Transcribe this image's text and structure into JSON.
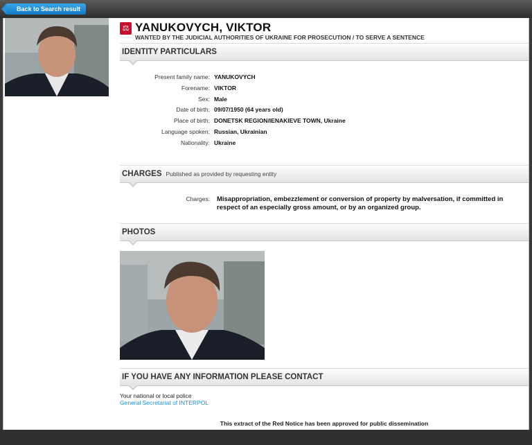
{
  "nav": {
    "back_label": "Back to Search result"
  },
  "header": {
    "name": "YANUKOVYCH, VIKTOR",
    "subtitle": "WANTED BY THE JUDICIAL AUTHORITIES OF UKRAINE FOR PROSECUTION / TO SERVE A SENTENCE",
    "logo_icon": "interpol-logo-icon"
  },
  "identity": {
    "title": "IDENTITY PARTICULARS",
    "rows": [
      {
        "label": "Present family name:",
        "value": "YANUKOVYCH"
      },
      {
        "label": "Forename:",
        "value": "VIKTOR"
      },
      {
        "label": "Sex:",
        "value": "Male"
      },
      {
        "label": "Date of birth:",
        "value": "09/07/1950 (64 years old)"
      },
      {
        "label": "Place of birth:",
        "value": "DONETSK REGION/IENAKIEVE TOWN, Ukraine"
      },
      {
        "label": "Language spoken:",
        "value": "Russian, Ukrainian"
      },
      {
        "label": "Nationality:",
        "value": "Ukraine"
      }
    ]
  },
  "charges": {
    "title": "CHARGES",
    "subtitle": "Published as provided by requesting entity",
    "label": "Charges:",
    "value": "Misappropriation, embezzlement or conversion of property by malversation, if committed in respect of an especially gross amount, or by an organized group."
  },
  "photos": {
    "title": "PHOTOS"
  },
  "contact": {
    "title": "IF YOU HAVE ANY INFORMATION PLEASE CONTACT",
    "line1": "Your national or local police",
    "link": "General Secretariat of INTERPOL"
  },
  "footer": {
    "note": "This extract of the Red Notice has been approved for public dissemination"
  },
  "colors": {
    "accent_link": "#1a8fd0",
    "back_button": "#1579c6",
    "logo_red": "#c8102e"
  }
}
